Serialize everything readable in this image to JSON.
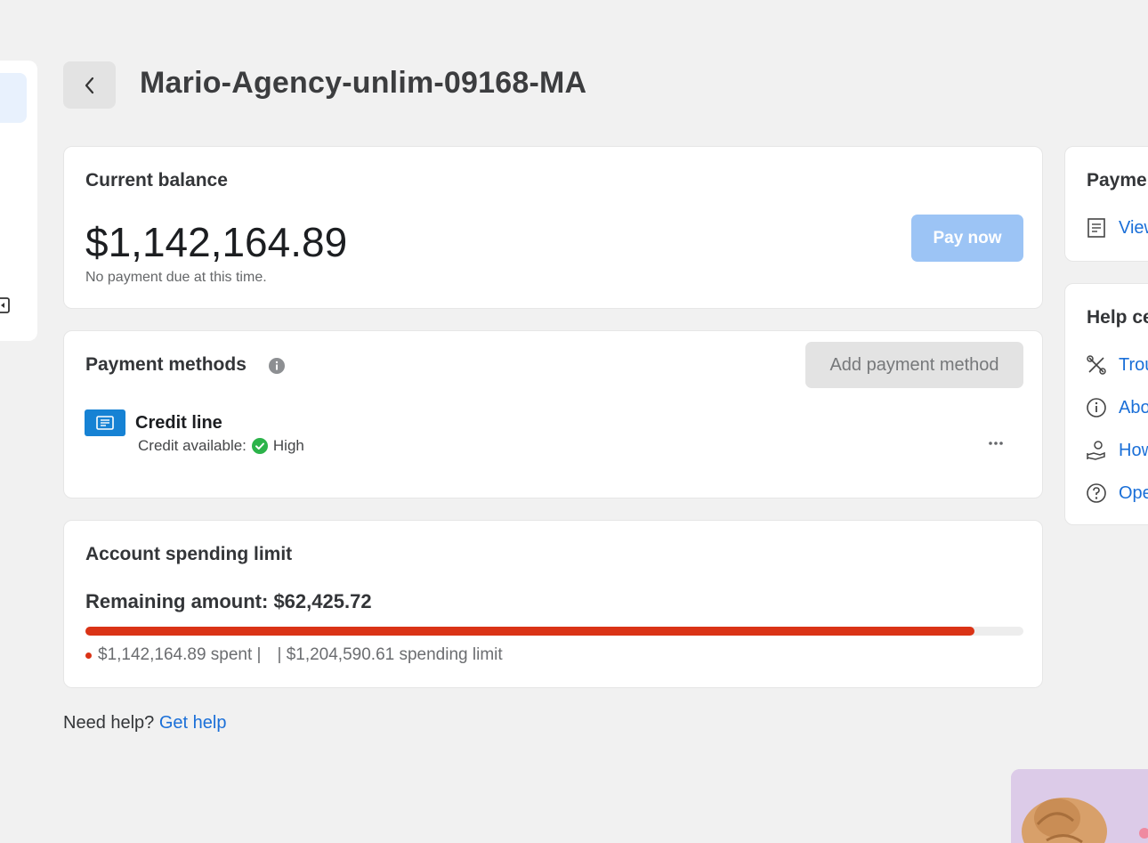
{
  "header": {
    "title": "Mario-Agency-unlim-09168-MA"
  },
  "balance": {
    "title": "Current balance",
    "amount": "$1,142,164.89",
    "note": "No payment due at this time.",
    "pay_label": "Pay now"
  },
  "methods": {
    "title": "Payment methods",
    "add_label": "Add payment method",
    "credit_name": "Credit line",
    "credit_avail_label": "Credit available:",
    "credit_avail_value": "High"
  },
  "limit": {
    "title": "Account spending limit",
    "remaining": "Remaining amount: $62,425.72",
    "spent_text": "$1,142,164.89 spent |",
    "limit_text": "| $1,204,590.61 spending limit",
    "spent_fraction": 0.9482
  },
  "help": {
    "question": "Need help?",
    "link": "Get help"
  },
  "right_panel": {
    "card1_title": "Payme",
    "card1_link": "View",
    "card2_title": "Help ce",
    "links": [
      "Trou",
      "Abo",
      "How",
      "Ope"
    ]
  },
  "colors": {
    "accent": "#1a6fd8",
    "danger": "#da3316",
    "disabled_primary": "#9cc4f5"
  }
}
